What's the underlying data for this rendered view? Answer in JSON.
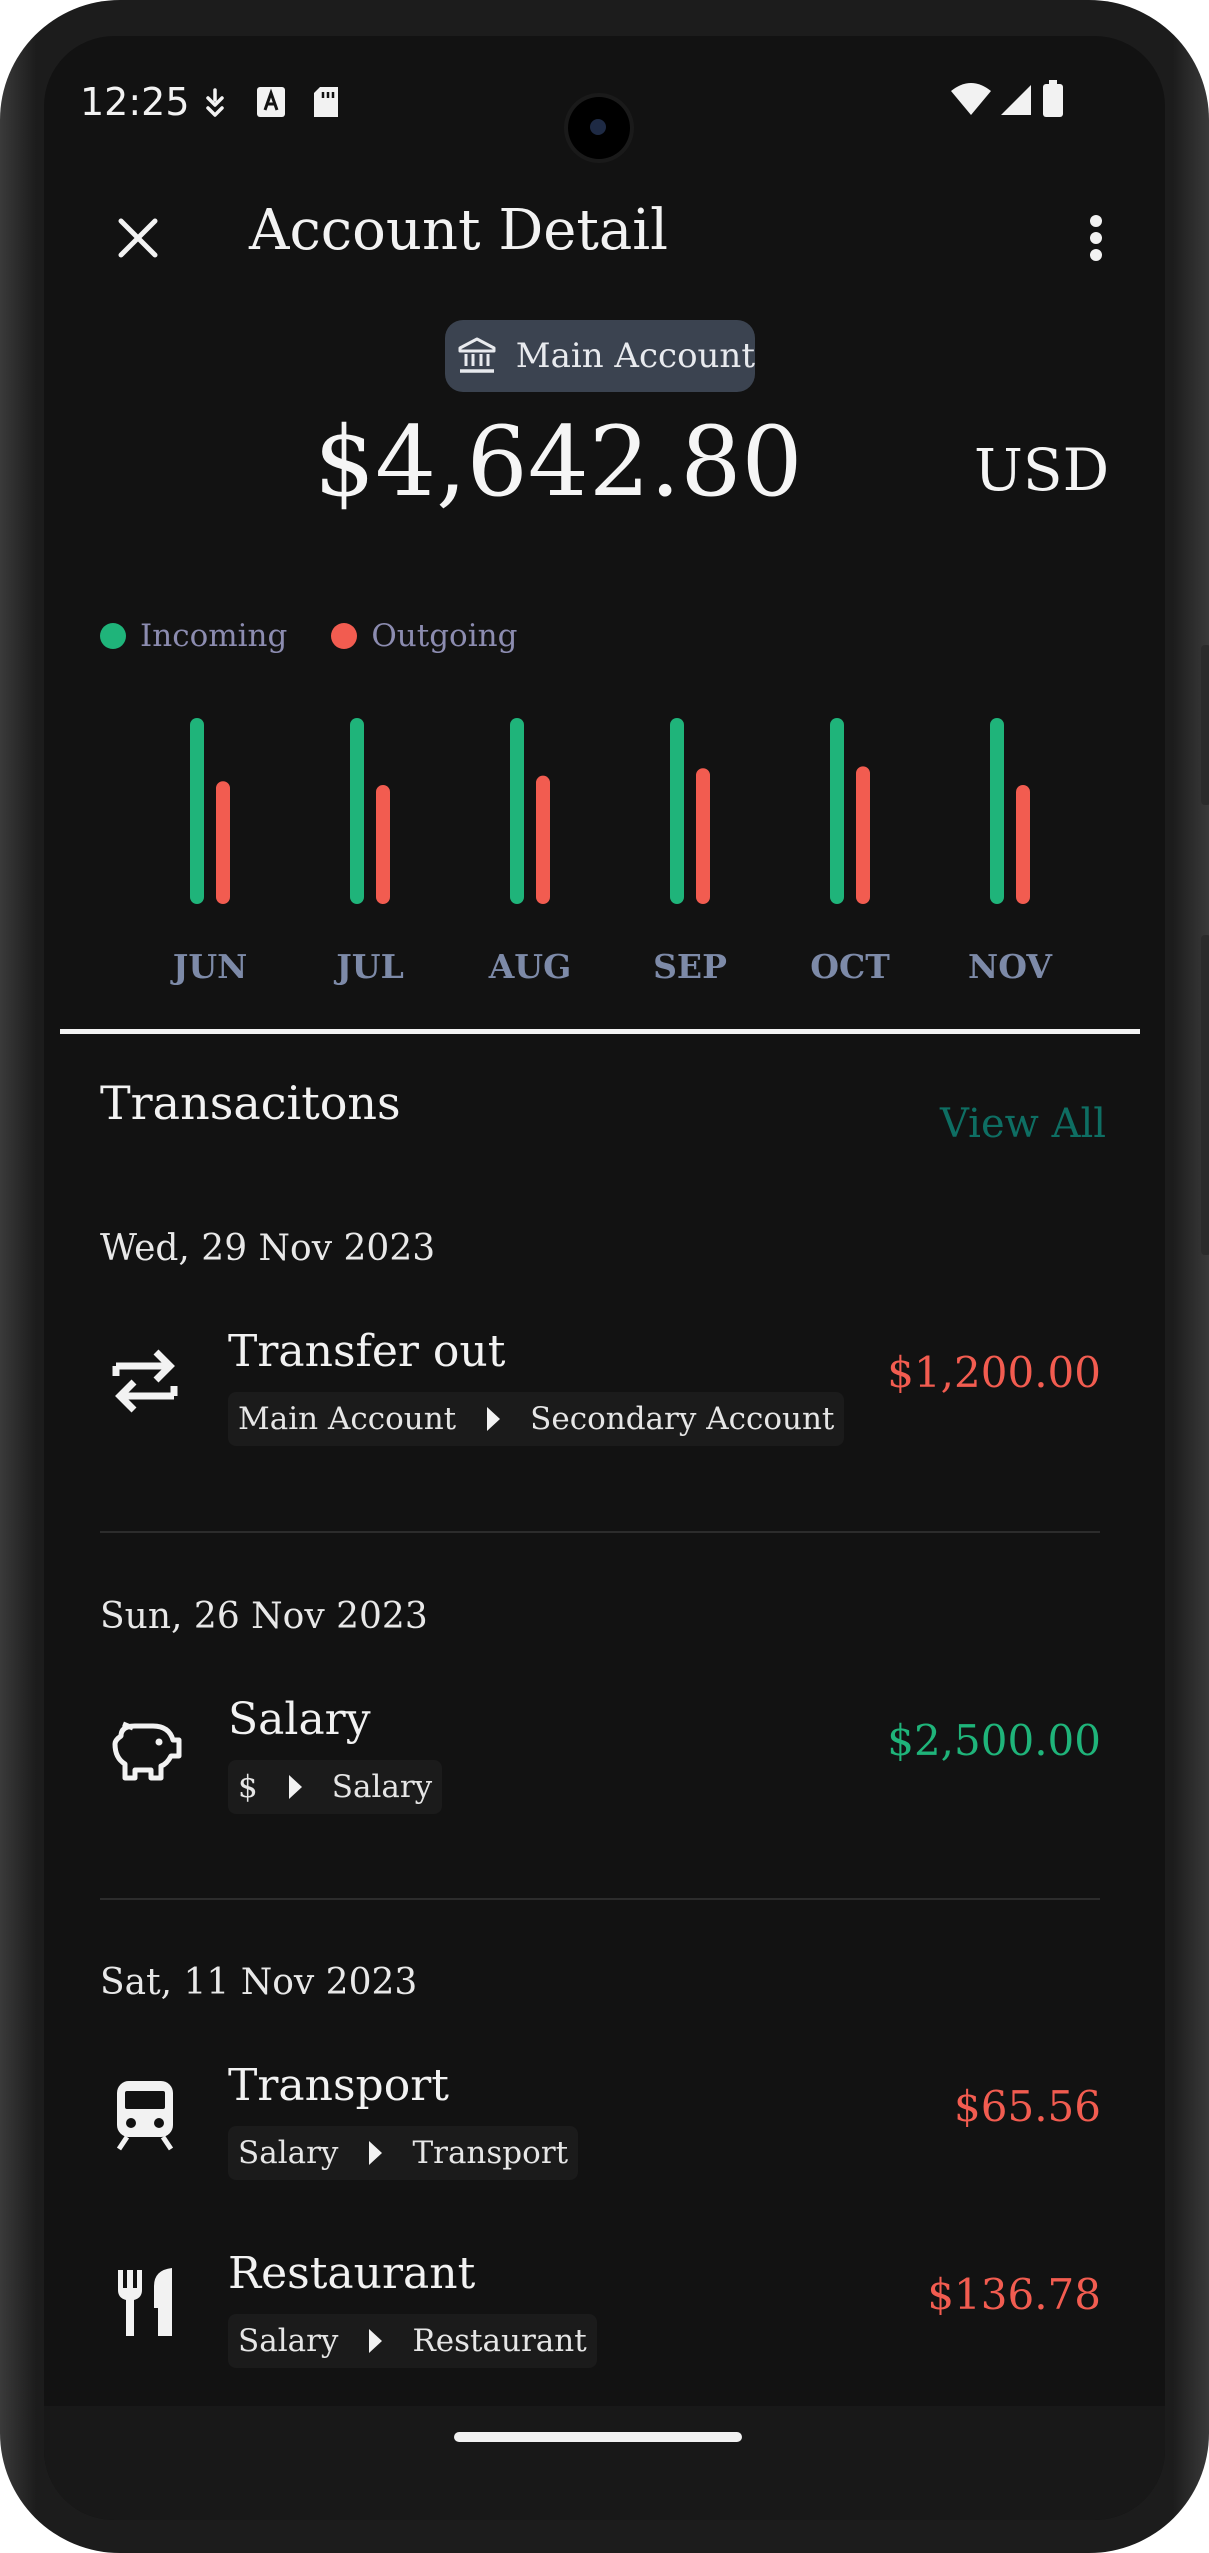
{
  "status_bar": {
    "time": "12:25"
  },
  "app_bar": {
    "title": "Account Detail"
  },
  "account": {
    "chip_label": "Main Account",
    "balance": "$4,642.80",
    "currency": "USD"
  },
  "colors": {
    "incoming": "#1fb47a",
    "outgoing": "#f25c50",
    "accent": "#0e6e63",
    "chip_bg": "#3b4350"
  },
  "chart_data": {
    "type": "bar",
    "categories": [
      "JUN",
      "JUL",
      "AUG",
      "SEP",
      "OCT",
      "NOV"
    ],
    "series": [
      {
        "name": "Incoming",
        "values": [
          100,
          100,
          100,
          100,
          100,
          100
        ]
      },
      {
        "name": "Outgoing",
        "values": [
          66,
          64,
          69,
          73,
          74,
          64
        ]
      }
    ],
    "legend_position": "top-left",
    "grid": false
  },
  "transactions": {
    "title": "Transacitons",
    "view_all": "View All",
    "groups": [
      {
        "date": "Wed, 29 Nov 2023",
        "items": [
          {
            "icon": "transfer-icon",
            "title": "Transfer out",
            "from": "Main Account",
            "to": "Secondary Account",
            "amount": "$1,200.00",
            "type": "outgoing"
          }
        ]
      },
      {
        "date": "Sun, 26 Nov 2023",
        "items": [
          {
            "icon": "piggy-bank-icon",
            "title": "Salary",
            "from": "$",
            "to": "Salary",
            "amount": "$2,500.00",
            "type": "incoming"
          }
        ]
      },
      {
        "date": "Sat, 11 Nov 2023",
        "items": [
          {
            "icon": "train-icon",
            "title": "Transport",
            "from": "Salary",
            "to": "Transport",
            "amount": "$65.56",
            "type": "outgoing"
          },
          {
            "icon": "restaurant-icon",
            "title": "Restaurant",
            "from": "Salary",
            "to": "Restaurant",
            "amount": "$136.78",
            "type": "outgoing"
          }
        ]
      }
    ]
  }
}
